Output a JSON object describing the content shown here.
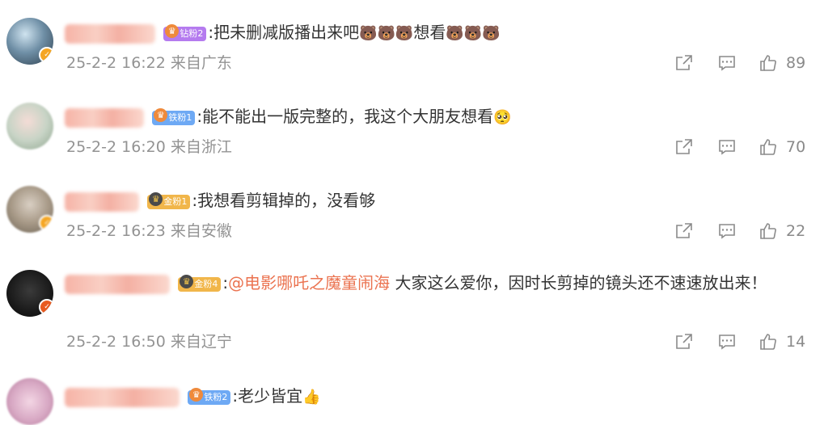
{
  "comments": [
    {
      "fan_badge": "钻粉2",
      "text": ":把未删减版播出来吧",
      "emoji_a": "🐻🐻🐻",
      "text_b": "想看",
      "emoji_b": "🐻🐻🐻",
      "meta": "25-2-2 16:22 来自广东",
      "likes": "89"
    },
    {
      "fan_badge": "铁粉1",
      "text": ":能不能出一版完整的，我这个大朋友想看",
      "emoji_a": "🥺",
      "meta": "25-2-2 16:20 来自浙江",
      "likes": "70"
    },
    {
      "fan_badge": "金粉1",
      "text": ":我想看剪辑掉的，没看够",
      "meta": "25-2-2 16:23 来自安徽",
      "likes": "22"
    },
    {
      "fan_badge": "金粉4",
      "text_pre": ":",
      "mention": "@电影哪吒之魔童闹海",
      "text": " 大家这么爱你，因时长剪掉的镜头还不速速放出来！",
      "meta": "25-2-2 16:50 来自辽宁",
      "likes": "14"
    },
    {
      "fan_badge": "铁粉2",
      "text": ":老少皆宜",
      "emoji_a": "👍"
    }
  ],
  "icons": {
    "share": "share-icon",
    "comment": "comment-icon",
    "like": "thumbs-up-icon"
  },
  "colors": {
    "mention": "#eb7350",
    "meta": "#939393"
  }
}
